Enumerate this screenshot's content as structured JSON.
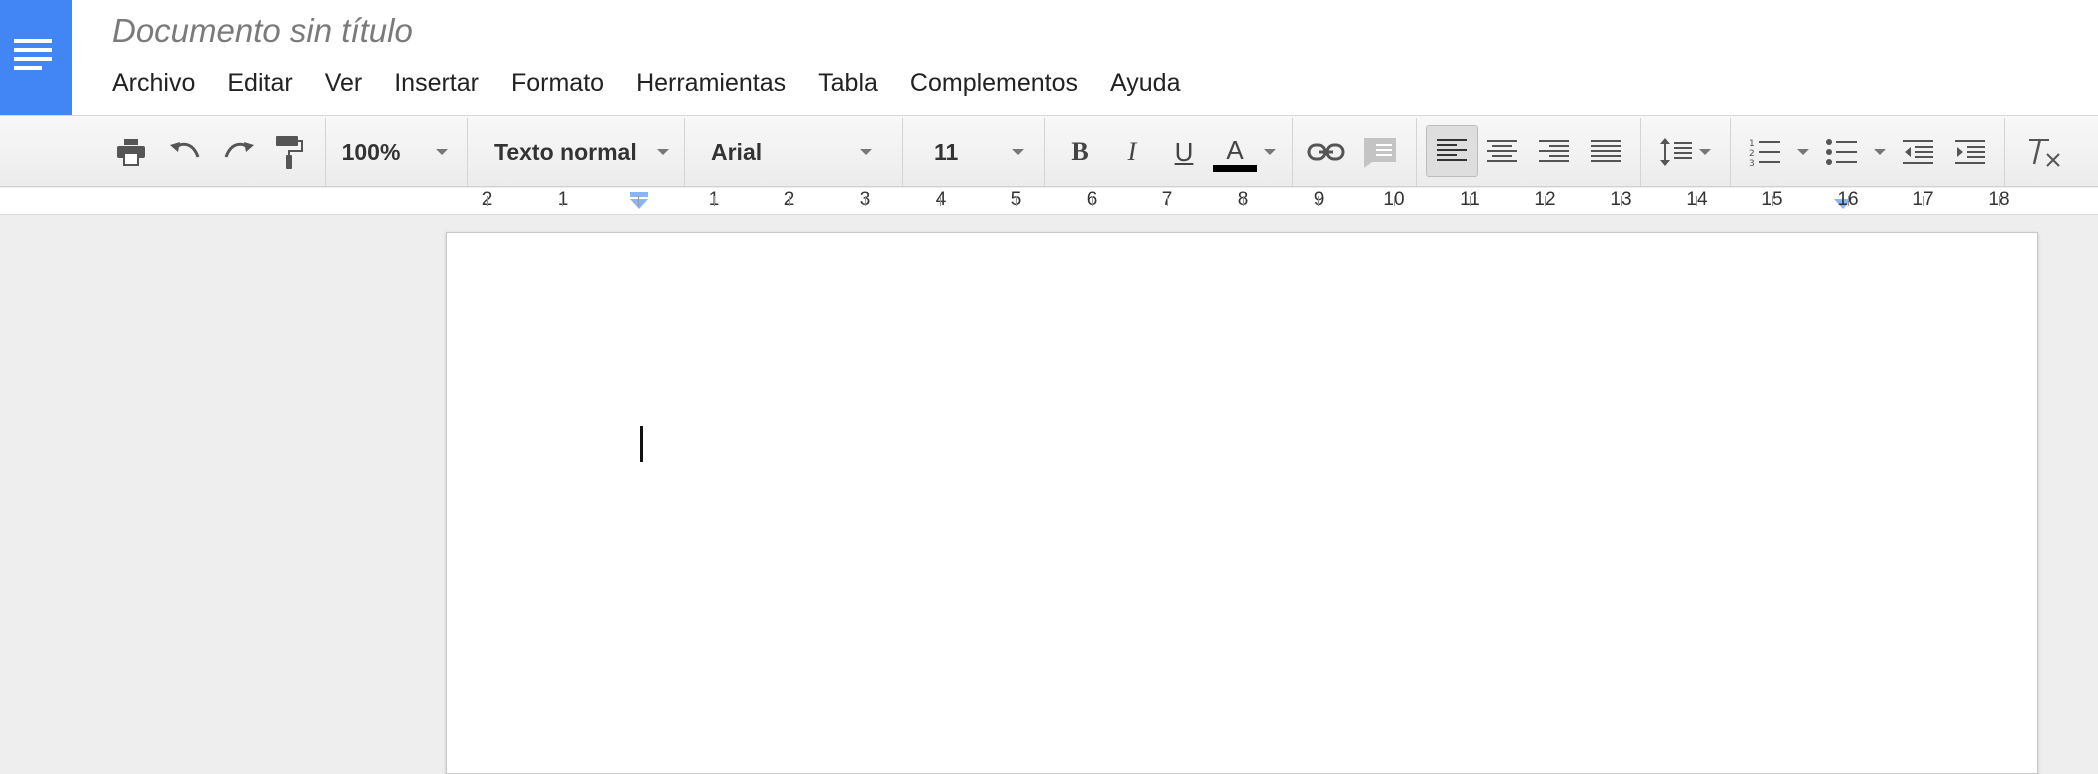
{
  "document": {
    "title": "Documento sin título"
  },
  "menu": [
    "Archivo",
    "Editar",
    "Ver",
    "Insertar",
    "Formato",
    "Herramientas",
    "Tabla",
    "Complementos",
    "Ayuda"
  ],
  "toolbar": {
    "zoom": "100%",
    "paragraph_style": "Texto normal",
    "font": "Arial",
    "font_size": "11",
    "bold_glyph": "B",
    "italic_glyph": "I",
    "underline_glyph": "U",
    "text_color_glyph": "A",
    "text_color": "#000000",
    "alignment": "left"
  },
  "icons": {
    "print": "print-icon",
    "undo": "undo-icon",
    "redo": "redo-icon",
    "paint_format": "paint-format-icon",
    "link": "link-icon",
    "comment": "comment-icon",
    "align_left": "align-left-icon",
    "align_center": "align-center-icon",
    "align_right": "align-right-icon",
    "align_justify": "align-justify-icon",
    "line_spacing": "line-spacing-icon",
    "numbered_list": "numbered-list-icon",
    "bulleted_list": "bulleted-list-icon",
    "decrease_indent": "decrease-indent-icon",
    "increase_indent": "increase-indent-icon",
    "clear_formatting": "clear-formatting-icon"
  },
  "ruler": {
    "left_labels": [
      "2",
      "1"
    ],
    "right_labels": [
      "1",
      "2",
      "3",
      "4",
      "5",
      "6",
      "7",
      "8",
      "9",
      "10",
      "11",
      "12",
      "13",
      "14",
      "15",
      "16",
      "17",
      "18"
    ]
  },
  "colors": {
    "brand": "#4285f4",
    "ruler_marker": "#8ab4f8",
    "canvas": "#eeeeee"
  }
}
